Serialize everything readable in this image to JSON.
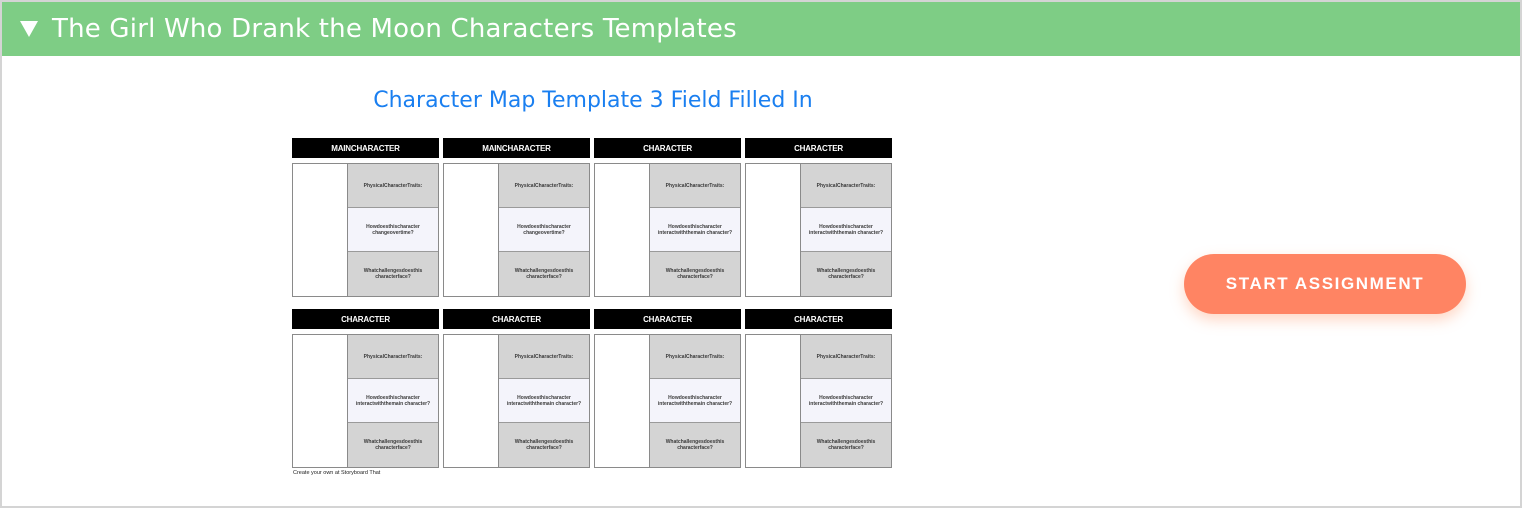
{
  "header": {
    "toggle_icon": "triangle-down-icon",
    "title": "The Girl Who Drank the Moon Characters Templates",
    "background_color": "#7ecd85"
  },
  "template": {
    "title": "Character Map Template 3 Field Filled In",
    "title_color": "#1a7ff0",
    "rows": [
      {
        "cards": [
          {
            "label": "MAINCHARACTER",
            "fields": [
              "PhysicalCharacterTraits:",
              "Howdoesthischaracter changeovertime?",
              "Whatchallengesdoesthis characterface?"
            ]
          },
          {
            "label": "MAINCHARACTER",
            "fields": [
              "PhysicalCharacterTraits:",
              "Howdoesthischaracter changeovertime?",
              "Whatchallengesdoesthis characterface?"
            ]
          },
          {
            "label": "CHARACTER",
            "fields": [
              "PhysicalCharacterTraits:",
              "Howdoesthischaracter interactwiththemain character?",
              "Whatchallengesdoesthis characterface?"
            ]
          },
          {
            "label": "CHARACTER",
            "fields": [
              "PhysicalCharacterTraits:",
              "Howdoesthischaracter interactwiththemain character?",
              "Whatchallengesdoesthis characterface?"
            ]
          }
        ]
      },
      {
        "cards": [
          {
            "label": "CHARACTER",
            "fields": [
              "PhysicalCharacterTraits:",
              "Howdoesthischaracter interactwiththemain character?",
              "Whatchallengesdoesthis characterface?"
            ]
          },
          {
            "label": "CHARACTER",
            "fields": [
              "PhysicalCharacterTraits:",
              "Howdoesthischaracter interactwiththemain character?",
              "Whatchallengesdoesthis characterface?"
            ]
          },
          {
            "label": "CHARACTER",
            "fields": [
              "PhysicalCharacterTraits:",
              "Howdoesthischaracter interactwiththemain character?",
              "Whatchallengesdoesthis characterface?"
            ]
          },
          {
            "label": "CHARACTER",
            "fields": [
              "PhysicalCharacterTraits:",
              "Howdoesthischaracter interactwiththemain character?",
              "Whatchallengesdoesthis characterface?"
            ]
          }
        ]
      }
    ],
    "credit": "Create your own at Storyboard That"
  },
  "actions": {
    "start_label": "START ASSIGNMENT",
    "start_color": "#ff8463"
  }
}
